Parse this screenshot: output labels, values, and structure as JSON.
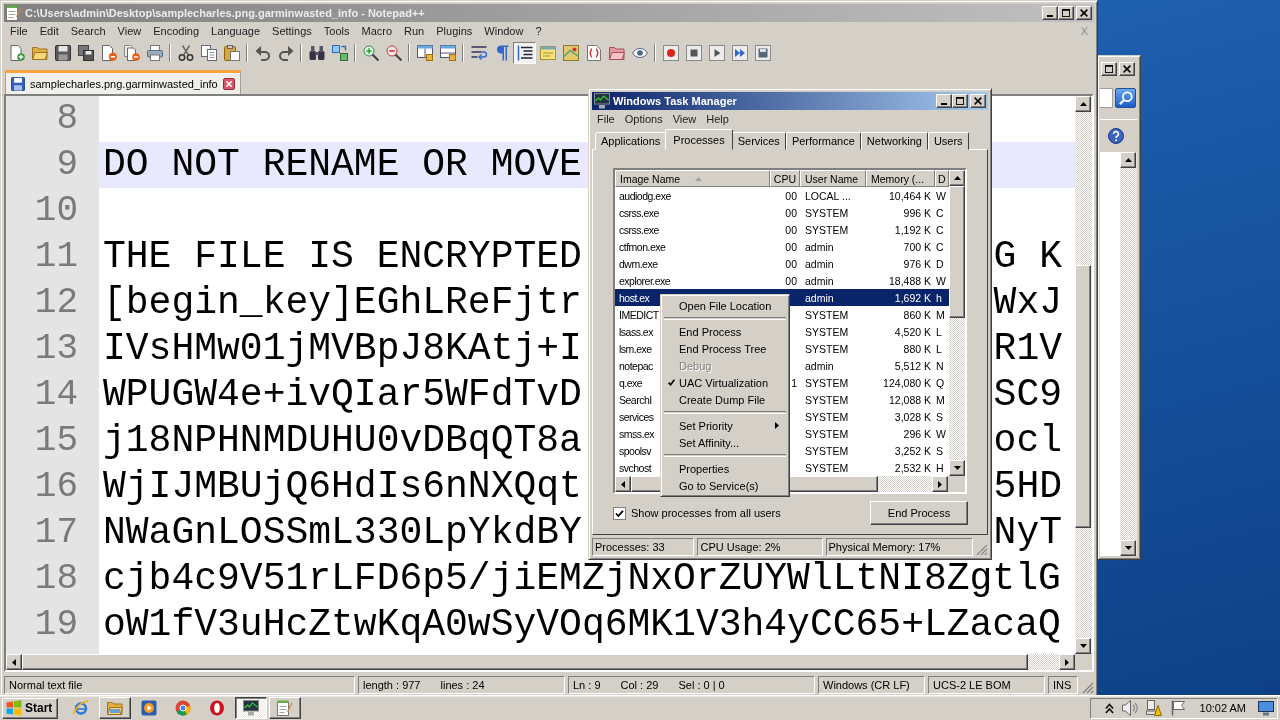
{
  "notepad": {
    "title": "C:\\Users\\admin\\Desktop\\samplecharles.png.garminwasted_info - Notepad++",
    "active": false,
    "menu": [
      "File",
      "Edit",
      "Search",
      "View",
      "Encoding",
      "Language",
      "Settings",
      "Tools",
      "Macro",
      "Run",
      "Plugins",
      "Window",
      "?"
    ],
    "menu_close": "X",
    "toolbar": [
      [
        {
          "kind": "new",
          "pressed": false
        },
        {
          "kind": "open",
          "pressed": false
        },
        {
          "kind": "save",
          "pressed": false
        },
        {
          "kind": "saveall",
          "pressed": false
        },
        {
          "kind": "close",
          "pressed": false
        },
        {
          "kind": "closeall",
          "pressed": false
        },
        {
          "kind": "print",
          "pressed": false
        }
      ],
      [
        {
          "kind": "cut",
          "pressed": false
        },
        {
          "kind": "copy",
          "pressed": false
        },
        {
          "kind": "paste",
          "pressed": false
        }
      ],
      [
        {
          "kind": "undo",
          "pressed": false
        },
        {
          "kind": "redo",
          "pressed": false
        }
      ],
      [
        {
          "kind": "find",
          "pressed": false
        },
        {
          "kind": "replace",
          "pressed": false
        }
      ],
      [
        {
          "kind": "zoomin",
          "pressed": false
        },
        {
          "kind": "zoomout",
          "pressed": false
        }
      ],
      [
        {
          "kind": "syncv",
          "pressed": false
        },
        {
          "kind": "synch",
          "pressed": false
        }
      ],
      [
        {
          "kind": "wrap",
          "pressed": false
        },
        {
          "kind": "allchars",
          "pressed": false
        },
        {
          "kind": "indent",
          "pressed": true
        },
        {
          "kind": "udl",
          "pressed": false
        },
        {
          "kind": "docmap",
          "pressed": false
        },
        {
          "kind": "funclist",
          "pressed": false
        },
        {
          "kind": "workspace",
          "pressed": false
        },
        {
          "kind": "monitor",
          "pressed": false
        }
      ],
      [
        {
          "kind": "record",
          "pressed": false
        },
        {
          "kind": "stop",
          "pressed": false
        },
        {
          "kind": "play",
          "pressed": false
        },
        {
          "kind": "playmulti",
          "pressed": false
        },
        {
          "kind": "savemacro",
          "pressed": false
        }
      ]
    ],
    "tabs": [
      {
        "label": "samplecharles.png.garminwasted_info",
        "selected": true
      }
    ],
    "lines": [
      {
        "number": "8",
        "current": false
      },
      {
        "number": "9",
        "text": "DO NOT RENAME OR MOVE",
        "current": true
      },
      {
        "number": "10",
        "current": false
      },
      {
        "number": "11",
        "text": "THE FILE IS ENCRYPTED",
        "text_right": "G K",
        "current": false
      },
      {
        "number": "12",
        "text": "[begin_key]EGhLReFjtr",
        "text_right": "WxJ",
        "current": false
      },
      {
        "number": "13",
        "text": "IVsHMw01jMVBpJ8KAtj+I",
        "text_right": "R1V",
        "current": false
      },
      {
        "number": "14",
        "text": "WPUGW4e+ivQIar5WFdTvD",
        "text_right": "SC9",
        "current": false
      },
      {
        "number": "15",
        "text": "j18NPHNMDUHU0vDBqQT8a",
        "text_right": "ocl",
        "current": false
      },
      {
        "number": "16",
        "text": "WjIJMBUjQ6HdIs6nNXQqt",
        "text_right": "5HD",
        "current": false
      },
      {
        "number": "17",
        "text": "NWaGnLOSSmL330LpYkdBY",
        "text_right": "NyT",
        "current": false
      },
      {
        "number": "18",
        "text": "cjb4c9V51rLFD6p5/jiEMZjNxOrZUYWlLtNI8ZgtlG",
        "current": false
      },
      {
        "number": "19",
        "text": "oW1fV3uHcZtwKqA0wSyVOq6MK1V3h4yCC65+LZacaQ",
        "current": false
      }
    ],
    "status_bar": [
      {
        "texts": [
          "Normal text file"
        ]
      },
      {
        "texts": [
          "length : 977",
          "lines : 24"
        ]
      },
      {
        "texts": [
          "Ln : 9",
          "Col : 29",
          "Sel : 0 | 0"
        ]
      },
      {
        "texts": [
          "Windows (CR LF)"
        ]
      },
      {
        "texts": [
          "UCS-2 LE BOM"
        ]
      },
      {
        "texts": [
          "INS"
        ]
      }
    ]
  },
  "task_manager": {
    "title": "Windows Task Manager",
    "active": true,
    "menu": [
      "File",
      "Options",
      "View",
      "Help"
    ],
    "tabs": [
      {
        "label": "Applications",
        "selected": false
      },
      {
        "label": "Processes",
        "selected": true
      },
      {
        "label": "Services",
        "selected": false
      },
      {
        "label": "Performance",
        "selected": false
      },
      {
        "label": "Networking",
        "selected": false
      },
      {
        "label": "Users",
        "selected": false
      }
    ],
    "columns": [
      {
        "label": "Image Name",
        "sorted": true
      },
      {
        "label": "CPU",
        "sorted": false
      },
      {
        "label": "User Name",
        "sorted": false
      },
      {
        "label": "Memory (...",
        "sorted": false
      },
      {
        "label": "D",
        "sorted": false
      }
    ],
    "rows": [
      {
        "image_name": "audiodg.exe",
        "cpu": "00",
        "user_name": "LOCAL ...",
        "memory": "10,464 K",
        "column_5": "W",
        "selected": false
      },
      {
        "image_name": "csrss.exe",
        "cpu": "00",
        "user_name": "SYSTEM",
        "memory": "996 K",
        "column_5": "C",
        "selected": false
      },
      {
        "image_name": "csrss.exe",
        "cpu": "00",
        "user_name": "SYSTEM",
        "memory": "1,192 K",
        "column_5": "C",
        "selected": false
      },
      {
        "image_name": "ctfmon.exe",
        "cpu": "00",
        "user_name": "admin",
        "memory": "700 K",
        "column_5": "C",
        "selected": false
      },
      {
        "image_name": "dwm.exe",
        "cpu": "00",
        "user_name": "admin",
        "memory": "976 K",
        "column_5": "D",
        "selected": false
      },
      {
        "image_name": "explorer.exe",
        "cpu": "00",
        "user_name": "admin",
        "memory": "18,488 K",
        "column_5": "W",
        "selected": false
      },
      {
        "image_name": "host.ex",
        "user_name": "admin",
        "memory": "1,692 K",
        "column_5": "h",
        "selected": true
      },
      {
        "image_name": "IMEDICT",
        "user_name": "SYSTEM",
        "memory": "860 K",
        "column_5": "M",
        "selected": false
      },
      {
        "image_name": "lsass.ex",
        "user_name": "SYSTEM",
        "memory": "4,520 K",
        "column_5": "L",
        "selected": false
      },
      {
        "image_name": "lsm.exe",
        "user_name": "SYSTEM",
        "memory": "880 K",
        "column_5": "L",
        "selected": false
      },
      {
        "image_name": "notepac",
        "user_name": "admin",
        "memory": "5,512 K",
        "column_5": "N",
        "selected": false
      },
      {
        "image_name": "q.exe",
        "cpu": "1",
        "user_name": "SYSTEM",
        "memory": "124,080 K",
        "column_5": "Q",
        "selected": false
      },
      {
        "image_name": "SearchI",
        "user_name": "SYSTEM",
        "memory": "12,088 K",
        "column_5": "M",
        "selected": false
      },
      {
        "image_name": "services",
        "user_name": "SYSTEM",
        "memory": "3,028 K",
        "column_5": "S",
        "selected": false
      },
      {
        "image_name": "smss.ex",
        "user_name": "SYSTEM",
        "memory": "296 K",
        "column_5": "W",
        "selected": false
      },
      {
        "image_name": "spoolsv",
        "user_name": "SYSTEM",
        "memory": "3,252 K",
        "column_5": "S",
        "selected": false
      },
      {
        "image_name": "svchost",
        "user_name": "SYSTEM",
        "memory": "2,532 K",
        "column_5": "H",
        "selected": false
      }
    ],
    "show_all_users": {
      "label": "Show processes from all users",
      "checked": true
    },
    "end_process": "End Process",
    "status_bar": [
      "Processes: 33",
      "CPU Usage: 2%",
      "Physical Memory: 17%"
    ]
  },
  "context_menu": {
    "items": [
      {
        "kind": "item",
        "label": "Open File Location",
        "disabled": false,
        "checked": false,
        "submenu": false
      },
      {
        "kind": "separator"
      },
      {
        "kind": "item",
        "label": "End Process",
        "disabled": false,
        "checked": false,
        "submenu": false
      },
      {
        "kind": "item",
        "label": "End Process Tree",
        "disabled": false,
        "checked": false,
        "submenu": false
      },
      {
        "kind": "item",
        "label": "Debug",
        "disabled": true,
        "checked": false,
        "submenu": false
      },
      {
        "kind": "item",
        "label": "UAC Virtualization",
        "disabled": false,
        "checked": true,
        "submenu": false
      },
      {
        "kind": "item",
        "label": "Create Dump File",
        "disabled": false,
        "checked": false,
        "submenu": false
      },
      {
        "kind": "separator"
      },
      {
        "kind": "item",
        "label": "Set Priority",
        "disabled": false,
        "checked": false,
        "submenu": true
      },
      {
        "kind": "item",
        "label": "Set Affinity...",
        "disabled": false,
        "checked": false,
        "submenu": false
      },
      {
        "kind": "separator"
      },
      {
        "kind": "item",
        "label": "Properties",
        "disabled": false,
        "checked": false,
        "submenu": false
      },
      {
        "kind": "item",
        "label": "Go to Service(s)",
        "disabled": false,
        "checked": false,
        "submenu": false
      }
    ]
  },
  "taskbar": {
    "start": "Start",
    "apps": [
      {
        "kind": "ie",
        "running": false,
        "active": false
      },
      {
        "kind": "explorer",
        "running": true,
        "active": false
      },
      {
        "kind": "media",
        "running": false,
        "active": false
      },
      {
        "kind": "chrome",
        "running": false,
        "active": false
      },
      {
        "kind": "opera",
        "running": false,
        "active": false
      },
      {
        "kind": "taskmgr",
        "running": true,
        "active": true
      },
      {
        "kind": "notepad",
        "running": true,
        "active": false
      }
    ],
    "clock": "10:02 AM"
  }
}
